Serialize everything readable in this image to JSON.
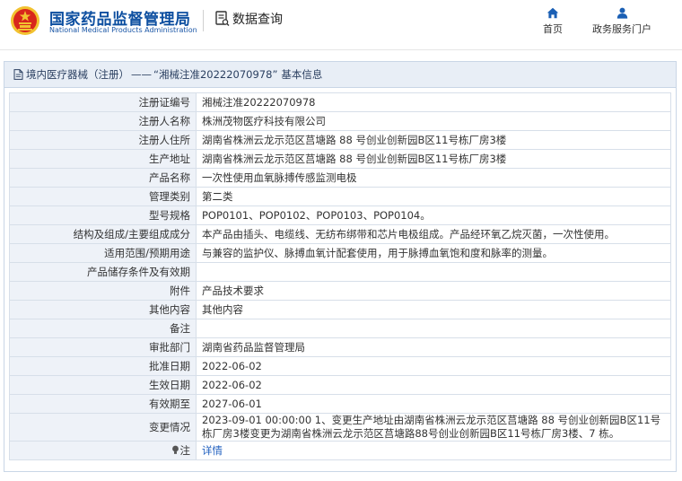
{
  "header": {
    "brand_cn": "国家药品监督管理局",
    "brand_en": "National Medical Products Administration",
    "query_label": "数据查询",
    "nav": [
      {
        "label": "首页",
        "icon": "home-icon"
      },
      {
        "label": "政务服务门户",
        "icon": "user-icon"
      }
    ]
  },
  "panel": {
    "title_category": "境内医疗器械（注册）",
    "title_dash": "——",
    "title_record": "“湘械注准20222070978”",
    "title_suffix": "基本信息"
  },
  "rows": [
    {
      "label": "注册证编号",
      "value": "湘械注准20222070978"
    },
    {
      "label": "注册人名称",
      "value": "株洲茂物医疗科技有限公司"
    },
    {
      "label": "注册人住所",
      "value": "湖南省株洲云龙示范区莒塘路 88 号创业创新园B区11号栋厂房3楼"
    },
    {
      "label": "生产地址",
      "value": "湖南省株洲云龙示范区莒塘路 88 号创业创新园B区11号栋厂房3楼"
    },
    {
      "label": "产品名称",
      "value": "一次性使用血氧脉搏传感监测电极"
    },
    {
      "label": "管理类别",
      "value": "第二类"
    },
    {
      "label": "型号规格",
      "value": "POP0101、POP0102、POP0103、POP0104。"
    },
    {
      "label": "结构及组成/主要组成成分",
      "value": "本产品由插头、电缆线、无纺布绑带和芯片电极组成。产品经环氧乙烷灭菌，一次性使用。"
    },
    {
      "label": "适用范围/预期用途",
      "value": "与兼容的监护仪、脉搏血氧计配套使用，用于脉搏血氧饱和度和脉率的测量。"
    },
    {
      "label": "产品储存条件及有效期",
      "value": ""
    },
    {
      "label": "附件",
      "value": "产品技术要求"
    },
    {
      "label": "其他内容",
      "value": "其他内容"
    },
    {
      "label": "备注",
      "value": ""
    },
    {
      "label": "审批部门",
      "value": "湖南省药品监督管理局"
    },
    {
      "label": "批准日期",
      "value": "2022-06-02"
    },
    {
      "label": "生效日期",
      "value": "2022-06-02"
    },
    {
      "label": "有效期至",
      "value": "2027-06-01"
    },
    {
      "label": "变更情况",
      "value": "2023-09-01 00:00:00 1、变更生产地址由湖南省株洲云龙示范区莒塘路 88 号创业创新园B区11号栋厂房3楼变更为湖南省株洲云龙示范区莒塘路88号创业创新园B区11号栋厂房3楼、7 栋。"
    }
  ],
  "note_row": {
    "label": "注",
    "link": "详情"
  },
  "colors": {
    "brand_blue": "#0d4fa0",
    "label_bg": "#eef2f8",
    "border": "#d7dfe9",
    "link": "#1f5fbf",
    "emblem_red": "#d8261c",
    "emblem_gold": "#f2c230"
  }
}
